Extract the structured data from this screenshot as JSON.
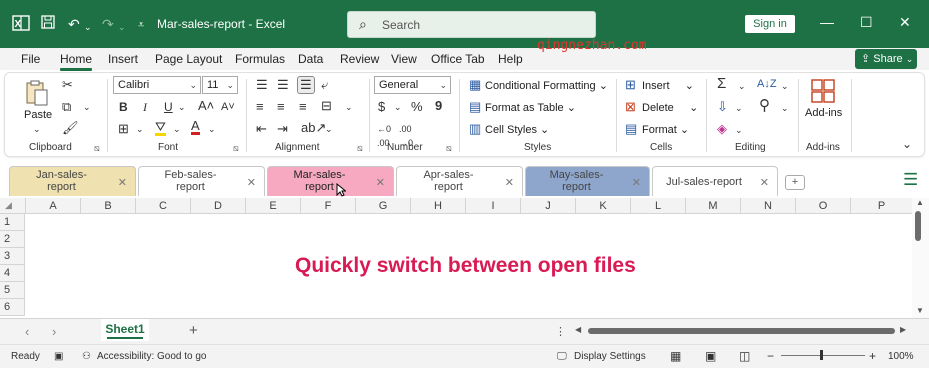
{
  "titlebar": {
    "doc_title": "Mar-sales-report  -  Excel",
    "search_placeholder": "Search",
    "sign_in": "Sign in"
  },
  "menu": {
    "tabs": [
      "File",
      "Home",
      "Insert",
      "Page Layout",
      "Formulas",
      "Data",
      "Review",
      "View",
      "Office Tab",
      "Help"
    ],
    "active": "Home",
    "share": "Share",
    "watermark": "qingnezhan.com"
  },
  "ribbon": {
    "clipboard": {
      "paste": "Paste",
      "label": "Clipboard"
    },
    "font": {
      "family": "Calibri",
      "size": "11",
      "label": "Font"
    },
    "alignment": {
      "label": "Alignment"
    },
    "number": {
      "format": "General",
      "label": "Number"
    },
    "styles": {
      "conditional": "Conditional Formatting",
      "format_table": "Format as Table",
      "cell_styles": "Cell Styles",
      "label": "Styles"
    },
    "cells": {
      "insert": "Insert",
      "delete": "Delete",
      "format": "Format",
      "label": "Cells"
    },
    "editing": {
      "label": "Editing"
    },
    "addins": {
      "button": "Add-ins",
      "label": "Add-ins"
    }
  },
  "doc_tabs": [
    {
      "line1": "Jan-sales-",
      "line2": "report",
      "color": "#efe1b0"
    },
    {
      "line1": "Feb-sales-",
      "line2": "report",
      "color": "#ffffff"
    },
    {
      "line1": "Mar-sales-",
      "line2": "report",
      "color": "#f6a9c1"
    },
    {
      "line1": "Apr-sales-",
      "line2": "report",
      "color": "#ffffff"
    },
    {
      "line1": "May-sales-",
      "line2": "report",
      "color": "#8fa6cc"
    },
    {
      "line1": "Jul-sales-report",
      "line2": "",
      "color": "#ffffff"
    }
  ],
  "columns": [
    "A",
    "B",
    "C",
    "D",
    "E",
    "F",
    "G",
    "H",
    "I",
    "J",
    "K",
    "L",
    "M",
    "N",
    "O",
    "P"
  ],
  "rows": [
    "1",
    "2",
    "3",
    "4",
    "5",
    "6"
  ],
  "caption": "Quickly switch between open files",
  "sheet": {
    "name": "Sheet1"
  },
  "status": {
    "ready": "Ready",
    "accessibility": "Accessibility: Good to go",
    "display_settings": "Display Settings",
    "zoom": "100%"
  },
  "colors": {
    "excel_green": "#1e7145",
    "caption": "#d81b55"
  }
}
